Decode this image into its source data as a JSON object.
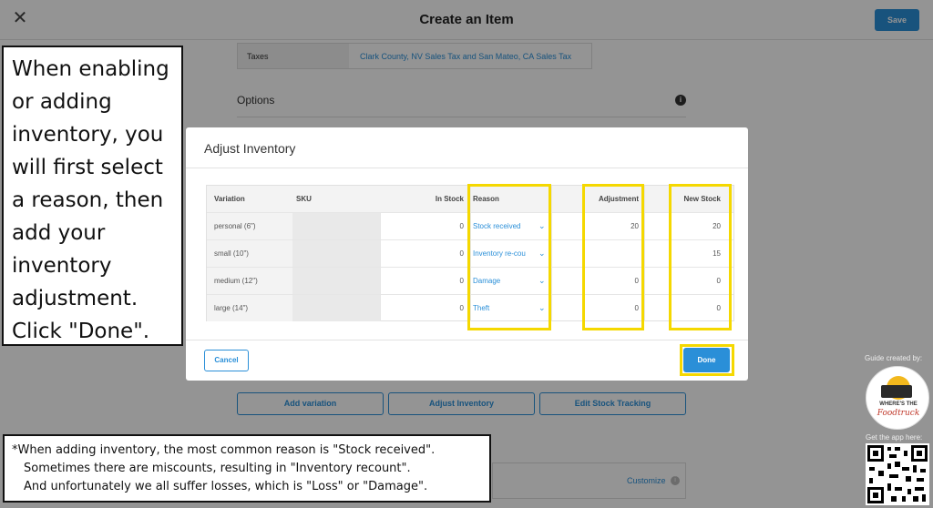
{
  "page": {
    "title": "Create an Item",
    "save_label": "Save",
    "close_icon": "close-icon",
    "taxes": {
      "label": "Taxes",
      "value": "Clark County, NV Sales Tax and San Mateo, CA Sales Tax"
    },
    "options_label": "Options",
    "actions": {
      "add_variation": "Add variation",
      "adjust_inventory": "Adjust Inventory",
      "edit_stock_tracking": "Edit Stock Tracking"
    },
    "customize_label": "Customize"
  },
  "modal": {
    "title": "Adjust Inventory",
    "headers": {
      "variation": "Variation",
      "sku": "SKU",
      "in_stock": "In Stock",
      "reason": "Reason",
      "adjustment": "Adjustment",
      "new_stock": "New Stock"
    },
    "rows": [
      {
        "variation": "personal (6\")",
        "sku": "",
        "in_stock": "0",
        "reason": "Stock received",
        "adjustment": "20",
        "new_stock": "20"
      },
      {
        "variation": "small (10\")",
        "sku": "",
        "in_stock": "0",
        "reason": "Inventory re-cou",
        "adjustment": "",
        "new_stock": "15"
      },
      {
        "variation": "medium (12\")",
        "sku": "",
        "in_stock": "0",
        "reason": "Damage",
        "adjustment": "0",
        "new_stock": "0"
      },
      {
        "variation": "large (14\")",
        "sku": "",
        "in_stock": "0",
        "reason": "Theft",
        "adjustment": "0",
        "new_stock": "0"
      }
    ],
    "cancel_label": "Cancel",
    "done_label": "Done"
  },
  "annotations": {
    "callout_lines": [
      "When enabling",
      "or adding",
      "inventory, you",
      "will first select",
      "a reason, then",
      "add your",
      "inventory",
      "adjustment.",
      "Click \"Done\"."
    ],
    "note_lines": [
      "*When adding inventory, the most common reason is \"Stock received\".",
      "Sometimes there are miscounts, resulting in \"Inventory recount\".",
      "And unfortunately we all suffer losses, which is \"Loss\" or \"Damage\"."
    ],
    "highlight_color": "#f5d800"
  },
  "branding": {
    "guide_label": "Guide created by:",
    "logo_text_top": "WHERE'S THE",
    "logo_text_bottom": "Foodtruck",
    "app_label": "Get the app here:"
  },
  "colors": {
    "accent": "#2a8fd8",
    "highlight": "#f5d800"
  }
}
